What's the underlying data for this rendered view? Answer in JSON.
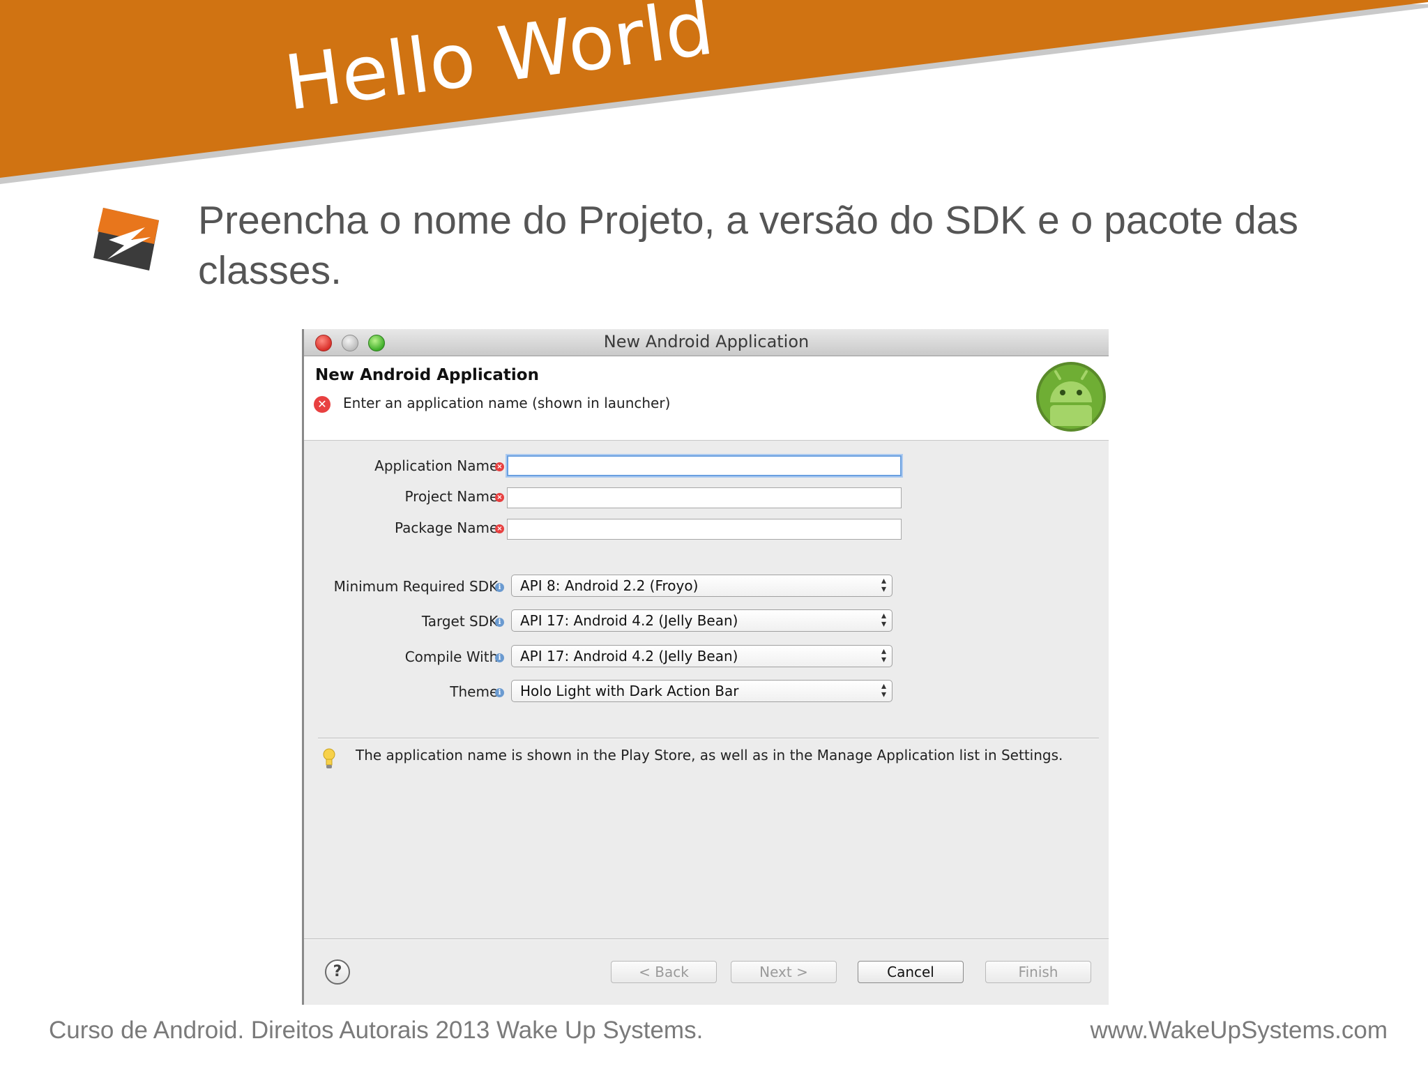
{
  "slide": {
    "title": "Hello World",
    "bullet": "Preencha o nome do Projeto, a versão do SDK e o pacote das classes.",
    "footer_left": "Curso de Android. Direitos Autorais 2013 Wake Up Systems.",
    "footer_right": "www.WakeUpSystems.com",
    "accent_color": "#D07312"
  },
  "dialog": {
    "window_title": "New Android Application",
    "header_title": "New Android Application",
    "header_message": "Enter an application name (shown in launcher)",
    "fields": {
      "application_name": {
        "label": "Application Name:",
        "value": ""
      },
      "project_name": {
        "label": "Project Name:",
        "value": ""
      },
      "package_name": {
        "label": "Package Name:",
        "value": ""
      }
    },
    "selects": {
      "min_sdk": {
        "label": "Minimum Required SDK:",
        "value": "API 8: Android 2.2 (Froyo)"
      },
      "target_sdk": {
        "label": "Target SDK:",
        "value": "API 17: Android 4.2 (Jelly Bean)"
      },
      "compile_with": {
        "label": "Compile With:",
        "value": "API 17: Android 4.2 (Jelly Bean)"
      },
      "theme": {
        "label": "Theme:",
        "value": "Holo Light with Dark Action Bar"
      }
    },
    "hint": "The application name is shown in the Play Store, as well as in the Manage Application list in Settings.",
    "buttons": {
      "back": "< Back",
      "next": "Next >",
      "cancel": "Cancel",
      "finish": "Finish"
    }
  }
}
